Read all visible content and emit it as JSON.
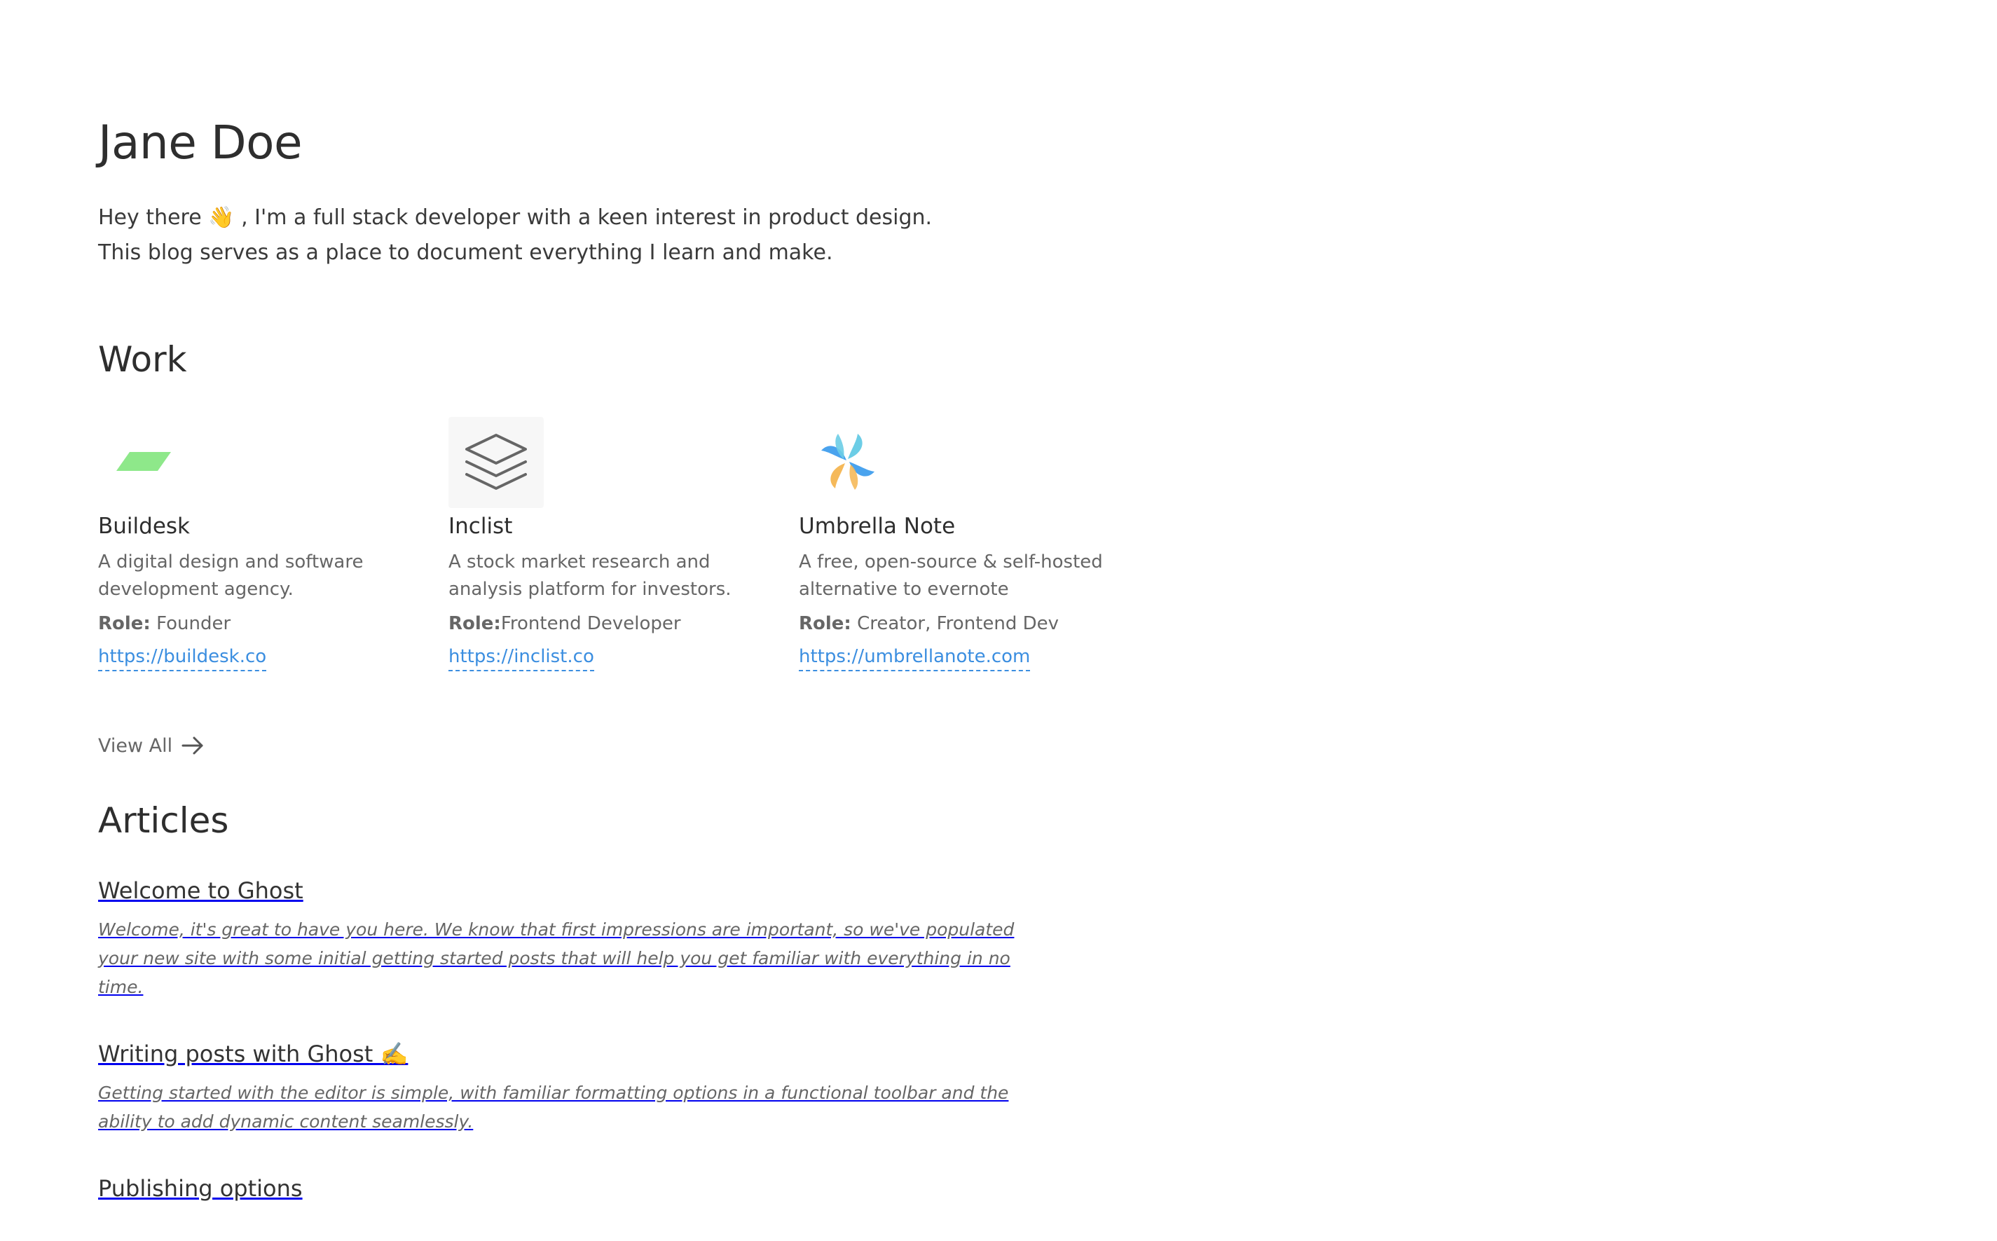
{
  "profile": {
    "name": "Jane Doe",
    "intro_before": "Hey there ",
    "wave_emoji": "👋",
    "intro_after": " , I'm a full stack developer with a keen interest in product design. This blog serves as a place to document everything I learn and make."
  },
  "work": {
    "title": "Work",
    "projects": [
      {
        "name": "Buildesk",
        "description": "A digital design and software development agency.",
        "role_label": "Role:",
        "role_value": " Founder",
        "link": "https://buildesk.co",
        "logo_icon": "buildesk-logo-icon"
      },
      {
        "name": "Inclist",
        "description": "A stock market research and analysis platform for investors.",
        "role_label": "Role:",
        "role_value": "Frontend Developer",
        "link": "https://inclist.co",
        "logo_icon": "inclist-layers-logo-icon"
      },
      {
        "name": "Umbrella Note",
        "description": "A free, open-source & self-hosted alternative to evernote",
        "role_label": "Role:",
        "role_value": " Creator, Frontend Dev",
        "link": "https://umbrellanote.com",
        "logo_icon": "umbrella-note-logo-icon"
      }
    ],
    "view_all_label": "View All",
    "view_all_icon": "arrow-right-icon"
  },
  "articles": {
    "title": "Articles",
    "items": [
      {
        "title": "Welcome to Ghost",
        "excerpt": "Welcome, it's great to have you here. We know that first impressions are important, so we've populated your new site with some initial getting started posts that will help you get familiar with everything in no time."
      },
      {
        "title": "Writing posts with Ghost ",
        "title_emoji": "✍️",
        "excerpt": "Getting started with the editor is simple, with familiar formatting options in a functional toolbar and the ability to add dynamic content seamlessly."
      },
      {
        "title": "Publishing options",
        "excerpt": ""
      }
    ]
  },
  "colors": {
    "link": "#3b8ee0",
    "text": "#333333",
    "muted": "#666666",
    "buildesk_green": "#8ee88a",
    "umbrella_blue": "#4aa3ee",
    "umbrella_teal": "#6ccde6",
    "umbrella_orange": "#f5b95a"
  }
}
